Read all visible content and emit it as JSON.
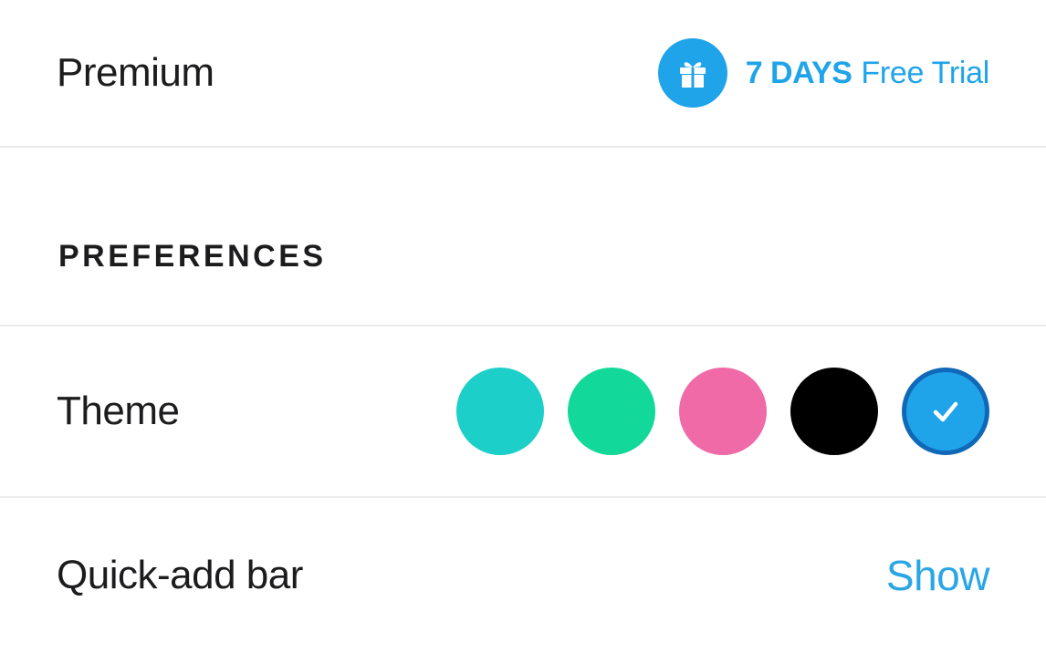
{
  "premium": {
    "label": "Premium",
    "gift_icon": "gift-icon",
    "trial_days": "7 DAYS",
    "trial_text": "Free Trial",
    "accent_color": "#1fa4ea"
  },
  "preferences": {
    "section_title": "PREFERENCES",
    "theme": {
      "label": "Theme",
      "swatches": [
        {
          "name": "teal",
          "color": "#1ccfc9",
          "selected": false
        },
        {
          "name": "green",
          "color": "#12d89a",
          "selected": false
        },
        {
          "name": "pink",
          "color": "#ef6aa6",
          "selected": false
        },
        {
          "name": "black",
          "color": "#000000",
          "selected": false
        },
        {
          "name": "blue",
          "color": "#1fa4ea",
          "selected": true
        }
      ],
      "selected_icon": "checkmark-icon"
    },
    "quick_add_bar": {
      "label": "Quick-add bar",
      "value": "Show"
    }
  }
}
